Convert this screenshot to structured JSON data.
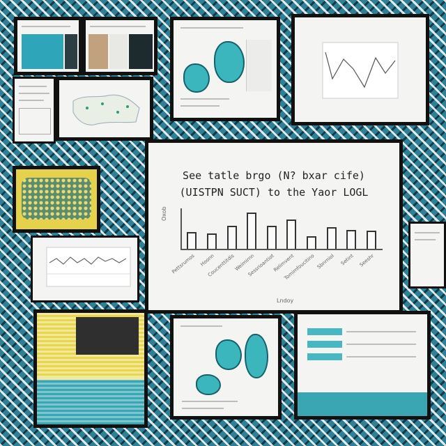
{
  "collage": {
    "colors": {
      "accent_teal": "#3cb6bd",
      "dark_teal": "#16606a",
      "yellow": "#e6d24a",
      "frame": "#111111",
      "background": "#2f7f95"
    }
  },
  "main_chart": {
    "title_line1": "See tatle brgo (N? bxar cife)",
    "title_line2": "(UISTPN SUCT) to the Yaor LOGL",
    "ylabel": "Oxob",
    "xlabel": "Lndoy",
    "ticks": [
      "Pettsrumos",
      "Hoonn",
      "Coucenttitdis",
      "Weimirnn",
      "Sessrioantiot",
      "Relimvent",
      "Tomimfoucitino",
      "Sbnrniol",
      "Setint",
      "Seeshr"
    ]
  },
  "chart_data": {
    "type": "bar",
    "title": "See tatle brgo (N? bxar cife) (UISTPN SUCT) to the Yaor LOGL",
    "xlabel": "Lndoy",
    "ylabel": "Oxob",
    "categories": [
      "Pettsrumos",
      "Hoonn",
      "Coucenttitdis",
      "Weimirnn",
      "Sessrioantiot",
      "Relimvent",
      "Tomimfoucitino",
      "Sbnrniol",
      "Setint",
      "Seeshr"
    ],
    "values": [
      4.5,
      4.2,
      6.2,
      9.8,
      6.3,
      7.9,
      3.5,
      5.8,
      5.1,
      4.9
    ],
    "ylim": [
      0,
      11
    ]
  },
  "small_text": {
    "s1": "— — —",
    "s2": "~"
  }
}
